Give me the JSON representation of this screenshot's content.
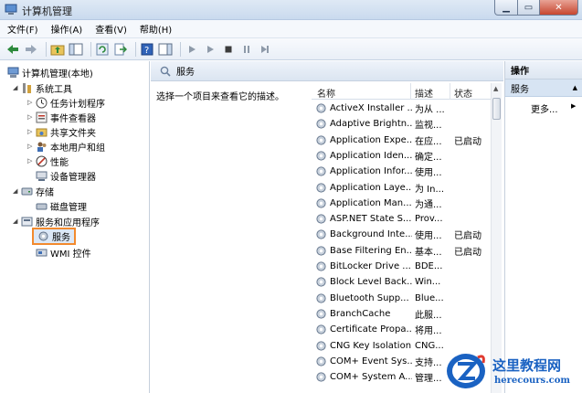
{
  "window": {
    "title": "计算机管理"
  },
  "menu": [
    "文件(F)",
    "操作(A)",
    "查看(V)",
    "帮助(H)"
  ],
  "tree": {
    "root": "计算机管理(本地)",
    "system_tools": "系统工具",
    "task_scheduler": "任务计划程序",
    "event_viewer": "事件查看器",
    "shared_folders": "共享文件夹",
    "local_users": "本地用户和组",
    "performance": "性能",
    "device_manager": "设备管理器",
    "storage": "存储",
    "disk_management": "磁盘管理",
    "services_apps": "服务和应用程序",
    "services": "服务",
    "wmi": "WMI 控件"
  },
  "center": {
    "title": "服务",
    "description": "选择一个项目来查看它的描述。",
    "columns": {
      "name": "名称",
      "desc": "描述",
      "status": "状态"
    },
    "rows": [
      {
        "name": "ActiveX Installer ...",
        "desc": "为从 ...",
        "status": ""
      },
      {
        "name": "Adaptive Brightn...",
        "desc": "监视...",
        "status": ""
      },
      {
        "name": "Application Expe...",
        "desc": "在应...",
        "status": "已启动"
      },
      {
        "name": "Application Iden...",
        "desc": "确定...",
        "status": ""
      },
      {
        "name": "Application Infor...",
        "desc": "使用...",
        "status": ""
      },
      {
        "name": "Application Laye...",
        "desc": "为 In...",
        "status": ""
      },
      {
        "name": "Application Man...",
        "desc": "为通...",
        "status": ""
      },
      {
        "name": "ASP.NET State S...",
        "desc": "Prov...",
        "status": ""
      },
      {
        "name": "Background Inte...",
        "desc": "使用...",
        "status": "已启动"
      },
      {
        "name": "Base Filtering En...",
        "desc": "基本...",
        "status": "已启动"
      },
      {
        "name": "BitLocker Drive ...",
        "desc": "BDE...",
        "status": ""
      },
      {
        "name": "Block Level Back...",
        "desc": "Win...",
        "status": ""
      },
      {
        "name": "Bluetooth Supp...",
        "desc": "Blue...",
        "status": ""
      },
      {
        "name": "BranchCache",
        "desc": "此服...",
        "status": ""
      },
      {
        "name": "Certificate Propa...",
        "desc": "将用...",
        "status": ""
      },
      {
        "name": "CNG Key Isolation",
        "desc": "CNG...",
        "status": ""
      },
      {
        "name": "COM+ Event Sys...",
        "desc": "支持...",
        "status": ""
      },
      {
        "name": "COM+ System A...",
        "desc": "管理...",
        "status": ""
      }
    ]
  },
  "actions": {
    "title": "操作",
    "section": "服务",
    "more": "更多..."
  },
  "watermark": {
    "brand": "这里教程网",
    "url": "herecours.com"
  },
  "colors": {
    "selection_outline": "#f28a2e",
    "watermark": "#1a62c2"
  }
}
